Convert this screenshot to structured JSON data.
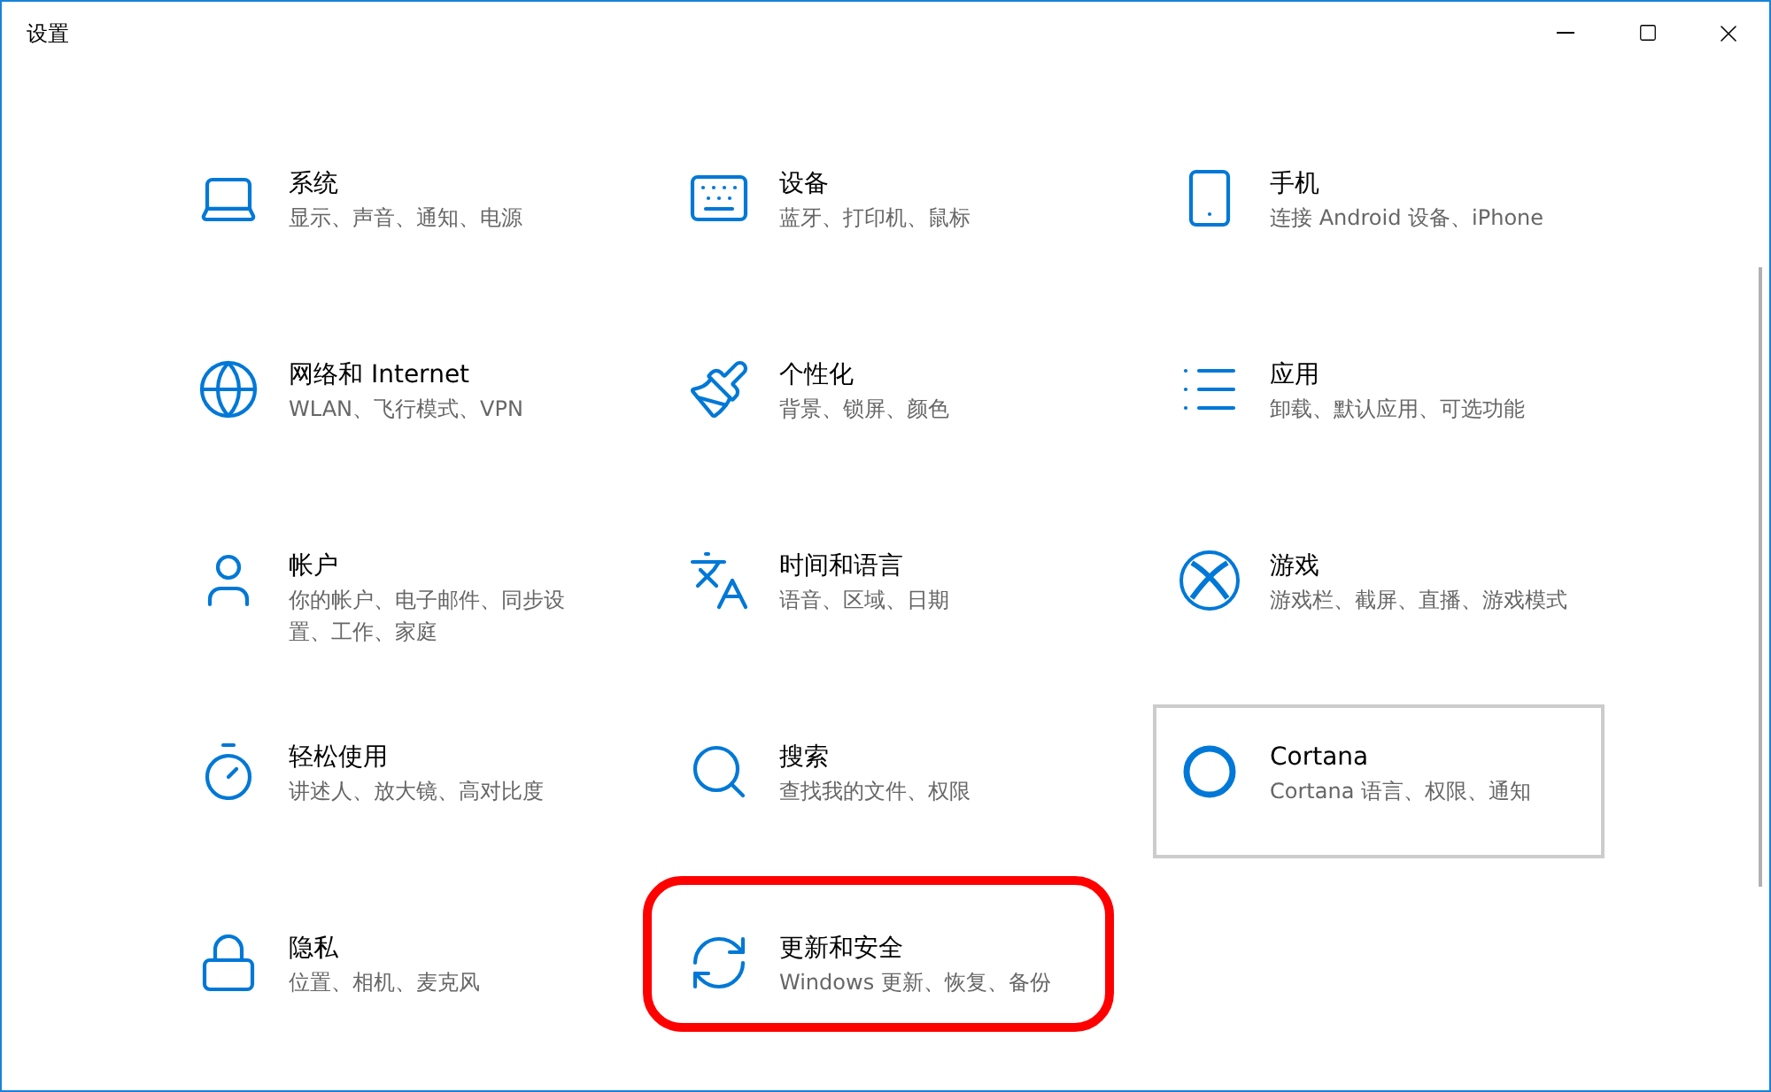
{
  "window": {
    "title": "设置"
  },
  "items": [
    {
      "title": "系统",
      "subtitle": "显示、声音、通知、电源",
      "hovered": false,
      "highlighted": false
    },
    {
      "title": "设备",
      "subtitle": "蓝牙、打印机、鼠标",
      "hovered": false,
      "highlighted": false
    },
    {
      "title": "手机",
      "subtitle": "连接 Android 设备、iPhone",
      "hovered": false,
      "highlighted": false
    },
    {
      "title": "网络和 Internet",
      "subtitle": "WLAN、飞行模式、VPN",
      "hovered": false,
      "highlighted": false
    },
    {
      "title": "个性化",
      "subtitle": "背景、锁屏、颜色",
      "hovered": false,
      "highlighted": false
    },
    {
      "title": "应用",
      "subtitle": "卸载、默认应用、可选功能",
      "hovered": false,
      "highlighted": false
    },
    {
      "title": "帐户",
      "subtitle": "你的帐户、电子邮件、同步设置、工作、家庭",
      "hovered": false,
      "highlighted": false
    },
    {
      "title": "时间和语言",
      "subtitle": "语音、区域、日期",
      "hovered": false,
      "highlighted": false
    },
    {
      "title": "游戏",
      "subtitle": "游戏栏、截屏、直播、游戏模式",
      "hovered": false,
      "highlighted": false
    },
    {
      "title": "轻松使用",
      "subtitle": "讲述人、放大镜、高对比度",
      "hovered": false,
      "highlighted": false
    },
    {
      "title": "搜索",
      "subtitle": "查找我的文件、权限",
      "hovered": false,
      "highlighted": false
    },
    {
      "title": "Cortana",
      "subtitle": "Cortana 语言、权限、通知",
      "hovered": true,
      "highlighted": false
    },
    {
      "title": "隐私",
      "subtitle": "位置、相机、麦克风",
      "hovered": false,
      "highlighted": false
    },
    {
      "title": "更新和安全",
      "subtitle": "Windows 更新、恢复、备份",
      "hovered": false,
      "highlighted": true
    }
  ]
}
